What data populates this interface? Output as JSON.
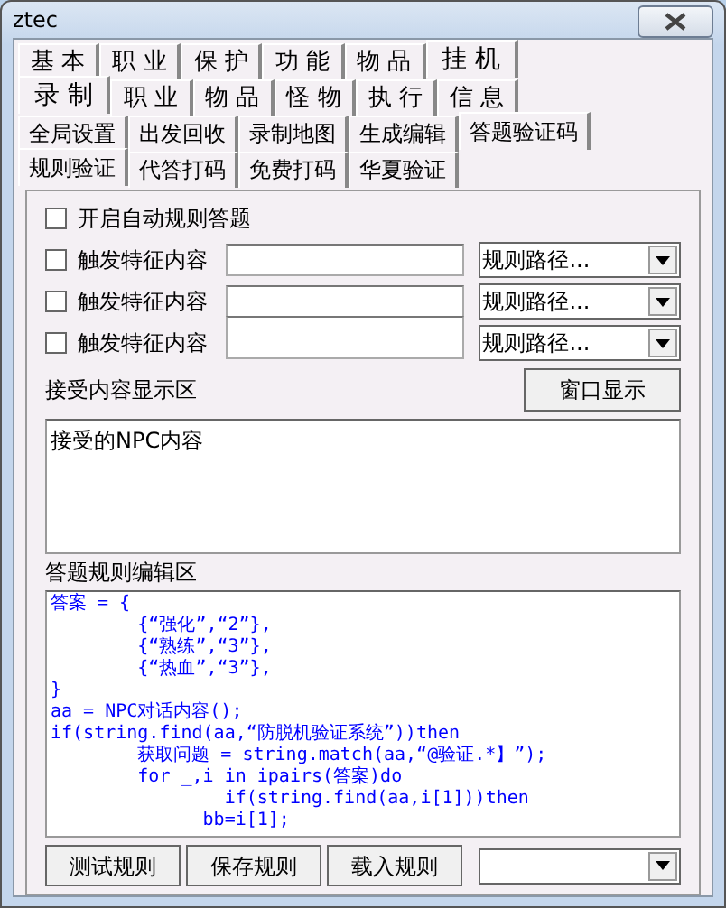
{
  "window": {
    "title": "ztec"
  },
  "tab_rows": [
    {
      "tabs": [
        {
          "label": "基 本",
          "selected": false
        },
        {
          "label": "职 业",
          "selected": false
        },
        {
          "label": "保 护",
          "selected": false
        },
        {
          "label": "功 能",
          "selected": false
        },
        {
          "label": "物 品",
          "selected": false
        },
        {
          "label": "挂 机",
          "selected": true
        }
      ]
    },
    {
      "tabs": [
        {
          "label": "录 制",
          "selected": true
        },
        {
          "label": "职 业",
          "selected": false
        },
        {
          "label": "物 品",
          "selected": false
        },
        {
          "label": "怪 物",
          "selected": false
        },
        {
          "label": "执 行",
          "selected": false
        },
        {
          "label": "信 息",
          "selected": false
        }
      ]
    },
    {
      "tabs": [
        {
          "label": "全局设置",
          "selected": false
        },
        {
          "label": "出发回收",
          "selected": false
        },
        {
          "label": "录制地图",
          "selected": false
        },
        {
          "label": "生成编辑",
          "selected": false
        },
        {
          "label": "答题验证码",
          "selected": true
        }
      ]
    },
    {
      "tabs": [
        {
          "label": "规则验证",
          "selected": true
        },
        {
          "label": "代答打码",
          "selected": false
        },
        {
          "label": "免费打码",
          "selected": false
        },
        {
          "label": "华夏验证",
          "selected": false
        }
      ]
    }
  ],
  "auto_answer": {
    "label": "开启自动规则答题",
    "checked": false
  },
  "triggers": [
    {
      "label": "触发特征内容",
      "checked": false,
      "path": "规则路径..."
    },
    {
      "label": "触发特征内容",
      "checked": false,
      "path": "规则路径..."
    },
    {
      "label": "触发特征内容",
      "checked": false,
      "path": "规则路径..."
    }
  ],
  "received": {
    "label": "接受内容显示区",
    "button": "窗口显示",
    "content": "接受的NPC内容"
  },
  "editor": {
    "label": "答题规则编辑区",
    "lines": [
      "答案 = {",
      "        {“强化”,“2”},",
      "        {“熟练”,“3”},",
      "        {“热血”,“3”},",
      "}",
      "aa = NPC对话内容();",
      "if(string.find(aa,“防脱机验证系统”))then",
      "        获取问题 = string.match(aa,“@验证.*】”);",
      "        for _,i in ipairs(答案)do",
      "                if(string.find(aa,i[1]))then",
      "              bb=i[1];"
    ]
  },
  "buttons": [
    "测试规则",
    "保存规则",
    "载入规则"
  ]
}
